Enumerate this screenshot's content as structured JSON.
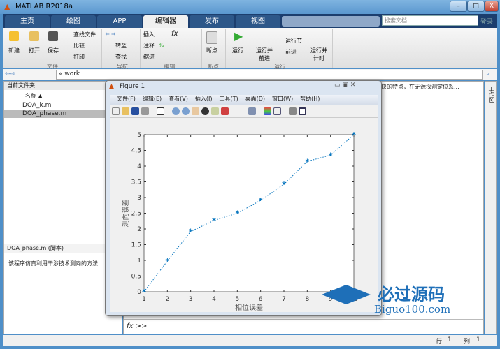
{
  "window": {
    "title": "MATLAB R2018a",
    "min": "–",
    "max": "□",
    "close": "X"
  },
  "tabs": [
    "主页",
    "绘图",
    "APP",
    "编辑器",
    "发布",
    "视图"
  ],
  "active_tab": "编辑器",
  "search": {
    "placeholder": "搜索文档",
    "login": "登录"
  },
  "ribbon": {
    "file": {
      "new": "新建",
      "open": "打开",
      "save": "保存",
      "find_files": "查找文件",
      "compare": "比较",
      "print": "打印",
      "group": "文件"
    },
    "nav": {
      "goto": "转至",
      "find": "查找",
      "group": "导航"
    },
    "edit": {
      "insert": "插入",
      "comment": "注释",
      "indent": "缩进",
      "fx": "fx",
      "percent": "%",
      "group": "编辑"
    },
    "breakpoints": {
      "label": "断点",
      "group": "断点"
    },
    "run": {
      "run": "运行",
      "run_advance": "运行并前进",
      "run_section": "运行节",
      "advance": "前进",
      "run_time": "运行并计时",
      "group": "运行"
    }
  },
  "address": {
    "path": "« work"
  },
  "current_folder": {
    "title": "当前文件夹",
    "col_name": "名称 ▲",
    "files": [
      "DOA_k.m",
      "DOA_phase.m"
    ],
    "selected": "DOA_phase.m"
  },
  "details": {
    "title": "DOA_phase.m  (脚本)",
    "description": "该程序仿真利用干涉技术测向的方法"
  },
  "editor_snippet": "快的特点，在无源探测定位系...",
  "workspace_tab": "工作区",
  "command": {
    "prompt": "fx >>"
  },
  "statusbar": {
    "row_label": "行",
    "row": "1",
    "col_label": "列",
    "col": "1"
  },
  "figure": {
    "title": "Figure 1",
    "menu": [
      "文件(F)",
      "编辑(E)",
      "查看(V)",
      "插入(I)",
      "工具(T)",
      "桌面(D)",
      "窗口(W)",
      "帮助(H)"
    ]
  },
  "watermark": {
    "cn": "必过源码",
    "en": "Biguo100.com"
  },
  "chart_data": {
    "type": "line",
    "x": [
      1,
      2,
      3,
      4,
      5,
      6,
      7,
      8,
      9,
      10
    ],
    "y": [
      0,
      0.98,
      1.92,
      2.27,
      2.5,
      2.91,
      3.42,
      4.15,
      4.35,
      5
    ],
    "xlabel": "相位误差",
    "ylabel": "测向误差",
    "xlim": [
      1,
      10
    ],
    "ylim": [
      0,
      5
    ],
    "xticks": [
      "1",
      "2",
      "3",
      "4",
      "5",
      "6",
      "7",
      "8",
      "9",
      "10"
    ],
    "yticks": [
      "0",
      "0.5",
      "1",
      "1.5",
      "2",
      "2.5",
      "3",
      "3.5",
      "4",
      "4.5",
      "5"
    ],
    "line_style": "dotted",
    "marker": "*",
    "color": "#0072bd",
    "grid": false
  }
}
